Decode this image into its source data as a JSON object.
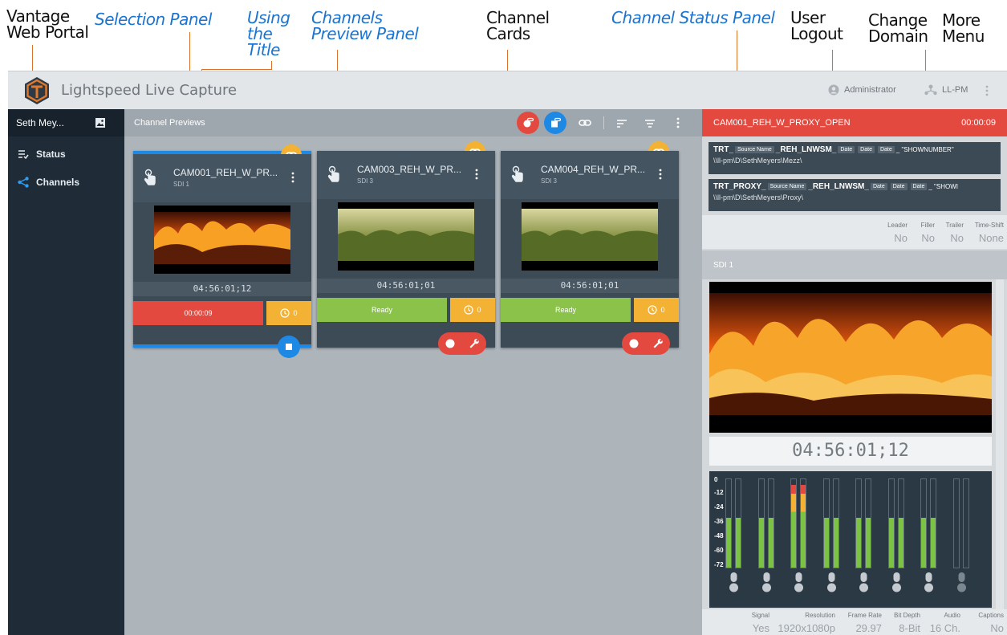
{
  "annotations": {
    "vantage_web_portal": [
      "Vantage",
      "Web Portal"
    ],
    "selection_panel": "Selection Panel",
    "using_the_title": [
      "Using",
      "the",
      "Title"
    ],
    "channels_preview_panel": [
      "Channels",
      "Preview Panel"
    ],
    "channel_cards": [
      "Channel",
      "Cards"
    ],
    "channel_status_panel": "Channel Status Panel",
    "user_logout": [
      "User",
      "Logout"
    ],
    "change_domain": [
      "Change",
      "Domain"
    ],
    "more_menu": [
      "More",
      "Menu"
    ]
  },
  "topbar": {
    "title": "Lightspeed Live Capture",
    "user": "Administrator",
    "domain": "LL-PM"
  },
  "sidebar": {
    "selection": "Seth Mey...",
    "items": [
      {
        "label": "Status",
        "icon": "status-list-icon"
      },
      {
        "label": "Channels",
        "icon": "share-icon"
      }
    ]
  },
  "preview": {
    "title": "Channel Previews",
    "cards": [
      {
        "name": "CAM001_REH_W_PR...",
        "source": "SDI 1",
        "timecode": "04:56:01;12",
        "status": "00:00:09",
        "status_color": "#e4493f",
        "clock_count": "0"
      },
      {
        "name": "CAM003_REH_W_PR...",
        "source": "SDI 3",
        "timecode": "04:56:01;01",
        "status": "Ready",
        "status_color": "#8bc34a",
        "clock_count": "0"
      },
      {
        "name": "CAM004_REH_W_PR...",
        "source": "SDI 3",
        "timecode": "04:56:01;01",
        "status": "Ready",
        "status_color": "#8bc34a",
        "clock_count": "0"
      }
    ]
  },
  "status_panel": {
    "channel": "CAM001_REH_W_PROXY_OPEN",
    "elapsed": "00:00:09",
    "targets": [
      {
        "prefix": "TRT_",
        "chips": [
          "Source Name"
        ],
        "mid": "_REH_LNWSM_",
        "chips2": [
          "Date",
          "Date",
          "Date"
        ],
        "tail": "_ \"SHOWNUMBER\"",
        "path": "\\\\ll-pm\\D\\SethMeyers\\Mezz\\"
      },
      {
        "prefix": "TRT_PROXY_",
        "chips": [
          "Source Name"
        ],
        "mid": "_REH_LNWSM_",
        "chips2": [
          "Date",
          "Date",
          "Date"
        ],
        "tail": "_ \"SHOWI",
        "path": "\\\\ll-pm\\D\\SethMeyers\\Proxy\\"
      }
    ],
    "options": [
      {
        "label": "Leader",
        "value": "No"
      },
      {
        "label": "Filler",
        "value": "No"
      },
      {
        "label": "Trailer",
        "value": "No"
      },
      {
        "label": "Time-Shift",
        "value": "None"
      }
    ],
    "source": "SDI 1",
    "timecode": "04:56:01;12",
    "meter_labels": [
      "0",
      "-12",
      "-24",
      "-36",
      "-48",
      "-60",
      "-72"
    ],
    "meter_levels": [
      0.55,
      0.55,
      0.55,
      0.55,
      0.92,
      0.92,
      0.55,
      0.55,
      0.55,
      0.55,
      0.55,
      0.55,
      0.55,
      0.55,
      0,
      0
    ],
    "signal_info": [
      {
        "label": "Signal",
        "value": "Yes"
      },
      {
        "label": "Resolution",
        "value": "1920x1080p"
      },
      {
        "label": "Frame Rate",
        "value": "29.97"
      },
      {
        "label": "Bit Depth",
        "value": "8-Bit"
      },
      {
        "label": "Audio",
        "value": "16 Ch."
      },
      {
        "label": "Captions",
        "value": "No"
      }
    ]
  }
}
